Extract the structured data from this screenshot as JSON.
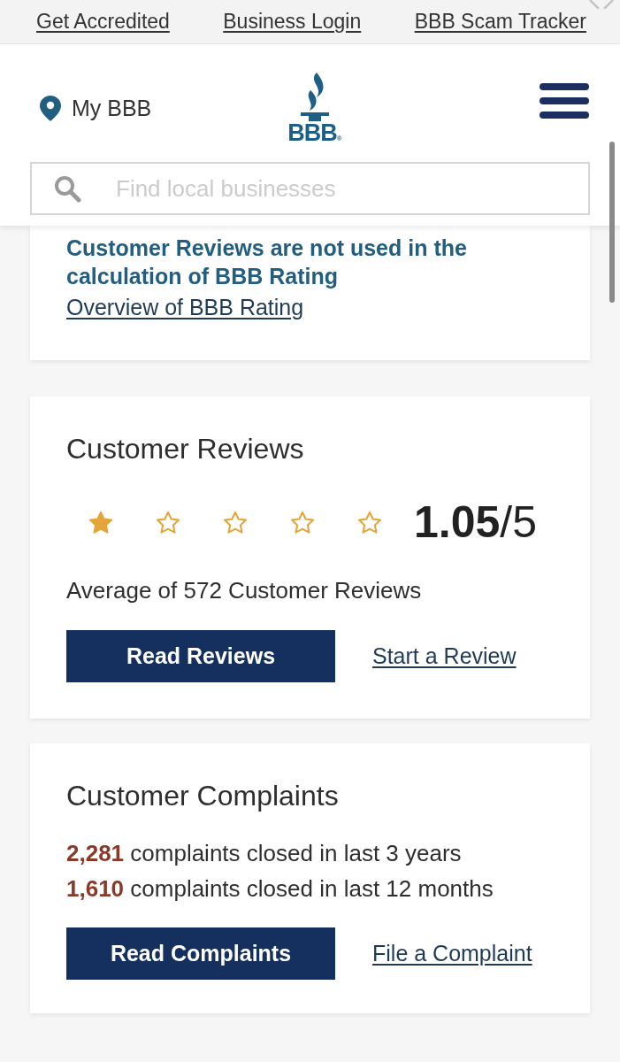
{
  "top_links": [
    {
      "label": "Get Accredited"
    },
    {
      "label": "Business Login"
    },
    {
      "label": "BBB Scam Tracker"
    }
  ],
  "header": {
    "location_label": "My BBB",
    "logo": {
      "text": "BBB",
      "mark": "®"
    },
    "search": {
      "placeholder": "Find local businesses"
    }
  },
  "rating_notice": {
    "text": "Customer Reviews are not used in the calculation of BBB Rating",
    "link": "Overview of BBB Rating"
  },
  "reviews": {
    "title": "Customer Reviews",
    "stars": 1,
    "score": "**1.05**/5",
    "summary": "Average of 572 Customer Reviews",
    "button": "Read Reviews",
    "link": "Start a Review"
  },
  "complaints": {
    "title": "Customer Complaints",
    "lines": [
      "**2,281** complaints closed in last 3 years",
      "**1,610** complaints closed in last 12 months"
    ],
    "button": "Read Complaints",
    "link": "File a Complaint"
  }
}
